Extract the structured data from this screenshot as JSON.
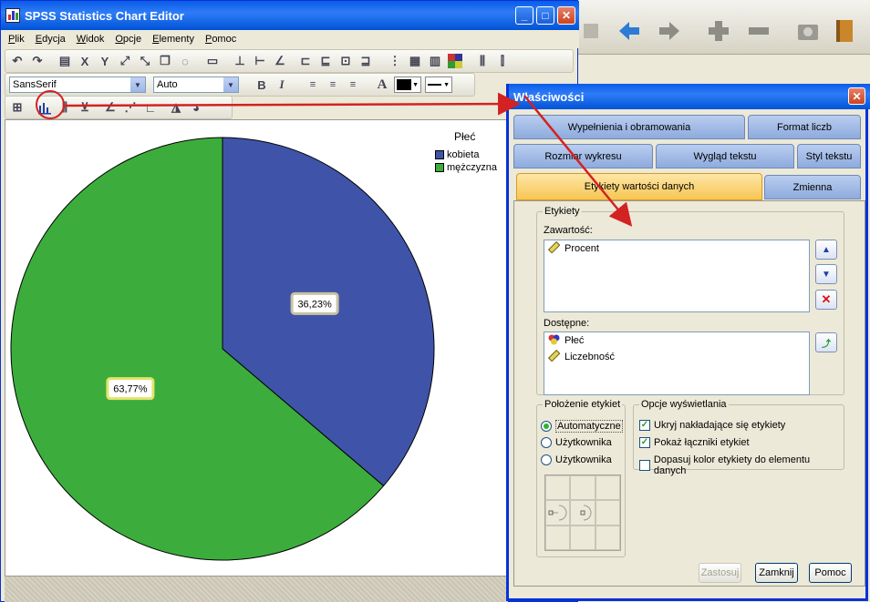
{
  "editor": {
    "title": "SPSS Statistics Chart Editor",
    "menu": [
      "Plik",
      "Edycja",
      "Widok",
      "Opcje",
      "Elementy",
      "Pomoc"
    ],
    "font_family_value": "SansSerif",
    "font_size_value": "Auto",
    "bold_label": "B",
    "italic_label": "I",
    "text_color_label": "A"
  },
  "chart": {
    "legend_title": "Płeć",
    "legend": [
      {
        "label": "kobieta",
        "color": "#3f54a8"
      },
      {
        "label": "mężczyzna",
        "color": "#3cad3c"
      }
    ],
    "labels": {
      "kobieta": "36,23%",
      "mezczyzna": "63,77%"
    }
  },
  "chart_data": {
    "type": "pie",
    "title": "",
    "categories": [
      "kobieta",
      "mężczyzna"
    ],
    "values": [
      36.23,
      63.77
    ],
    "unit": "%",
    "legend_title": "Płeć",
    "legend_position": "top-right"
  },
  "props": {
    "title": "Właściwości",
    "tabs": {
      "fill": "Wypełnienia i obramowania",
      "number": "Format liczb",
      "size": "Rozmiar wykresu",
      "text_look": "Wygląd tekstu",
      "text_style": "Styl tekstu",
      "data_labels": "Etykiety wartości danych",
      "variable": "Zmienna"
    },
    "labels_group": "Etykiety",
    "contents_label": "Zawartość:",
    "contents": [
      "Procent"
    ],
    "available_label": "Dostępne:",
    "available": [
      "Płeć",
      "Liczebność"
    ],
    "position_group": "Położenie etykiet",
    "position_options": [
      "Automatyczne",
      "Użytkownika",
      "Użytkownika"
    ],
    "display_group": "Opcje wyświetlania",
    "display_options": [
      {
        "label": "Ukryj nakładające się etykiety",
        "checked": true
      },
      {
        "label": "Pokaż łączniki etykiet",
        "checked": true
      },
      {
        "label": "Dopasuj kolor etykiety do elementu danych",
        "checked": false
      }
    ],
    "apply": "Zastosuj",
    "close": "Zamknij",
    "help": "Pomoc"
  }
}
